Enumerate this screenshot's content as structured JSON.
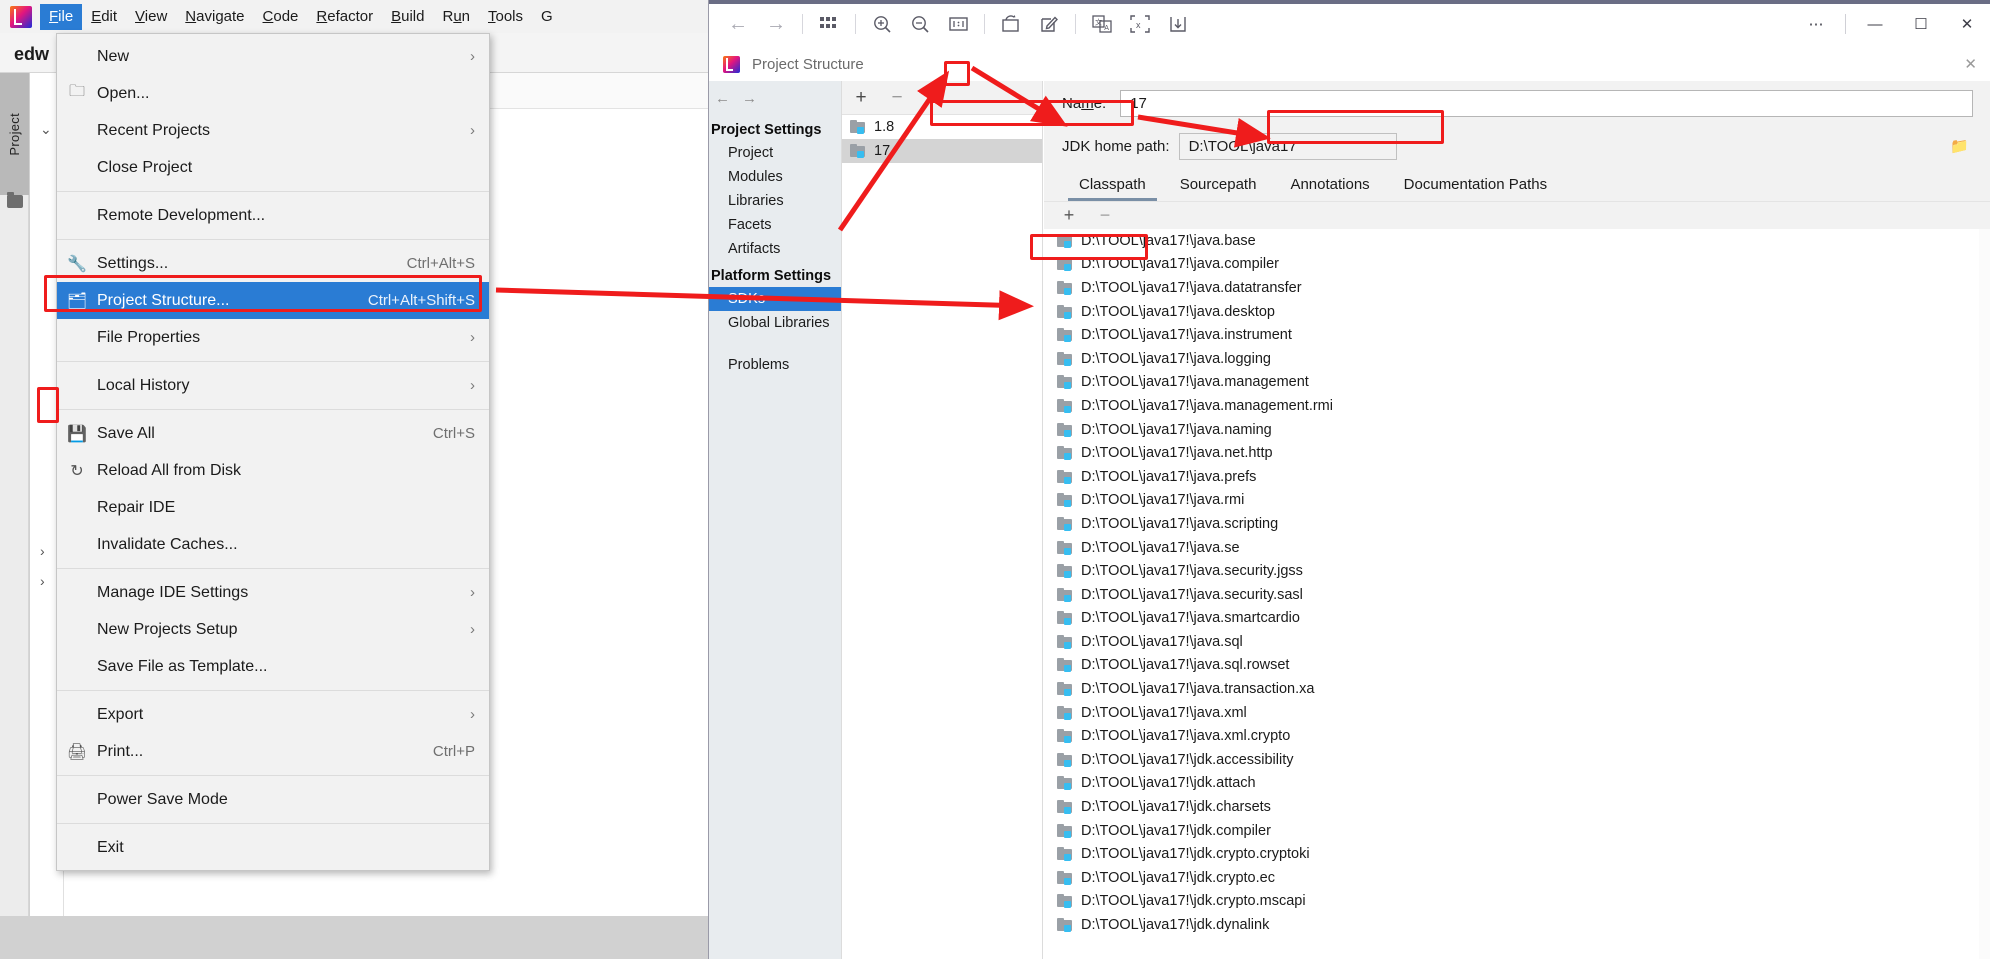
{
  "ide": {
    "logo_icon": "intellij-logo-icon",
    "tab_name": "edw",
    "stripe_label": "Project",
    "menubar": [
      {
        "label": "File",
        "mnemonic": "F",
        "active": true
      },
      {
        "label": "Edit",
        "mnemonic": "E",
        "active": false
      },
      {
        "label": "View",
        "mnemonic": "V",
        "active": false
      },
      {
        "label": "Navigate",
        "mnemonic": "N",
        "active": false
      },
      {
        "label": "Code",
        "mnemonic": "C",
        "active": false
      },
      {
        "label": "Refactor",
        "mnemonic": "R",
        "active": false
      },
      {
        "label": "Build",
        "mnemonic": "B",
        "active": false
      },
      {
        "label": "Run",
        "mnemonic": "u",
        "active": false
      },
      {
        "label": "Tools",
        "mnemonic": "T",
        "active": false
      },
      {
        "label": "G",
        "mnemonic": "",
        "active": false
      }
    ]
  },
  "file_menu": {
    "items": [
      {
        "label": "New",
        "mnemonic": "N",
        "accel": "",
        "arrow": true,
        "icon": "",
        "selected": false,
        "sep_after": false
      },
      {
        "label": "Open...",
        "mnemonic": "O",
        "accel": "",
        "arrow": false,
        "icon": "folder-icon",
        "selected": false,
        "sep_after": false
      },
      {
        "label": "Recent Projects",
        "mnemonic": "",
        "accel": "",
        "arrow": true,
        "icon": "",
        "selected": false,
        "sep_after": false
      },
      {
        "label": "Close Project",
        "mnemonic": "",
        "accel": "",
        "arrow": false,
        "icon": "",
        "selected": false,
        "sep_after": true
      },
      {
        "label": "Remote Development...",
        "mnemonic": "",
        "accel": "",
        "arrow": false,
        "icon": "",
        "selected": false,
        "sep_after": true
      },
      {
        "label": "Settings...",
        "mnemonic": "t",
        "accel": "Ctrl+Alt+S",
        "arrow": false,
        "icon": "wrench-icon",
        "selected": false,
        "sep_after": false
      },
      {
        "label": "Project Structure...",
        "mnemonic": "",
        "accel": "Ctrl+Alt+Shift+S",
        "arrow": false,
        "icon": "project-structure-icon",
        "selected": true,
        "sep_after": false
      },
      {
        "label": "File Properties",
        "mnemonic": "",
        "accel": "",
        "arrow": true,
        "icon": "",
        "selected": false,
        "sep_after": true
      },
      {
        "label": "Local History",
        "mnemonic": "H",
        "accel": "",
        "arrow": true,
        "icon": "",
        "selected": false,
        "sep_after": true
      },
      {
        "label": "Save All",
        "mnemonic": "S",
        "accel": "Ctrl+S",
        "arrow": false,
        "icon": "save-icon",
        "selected": false,
        "sep_after": false
      },
      {
        "label": "Reload All from Disk",
        "mnemonic": "",
        "accel": "",
        "arrow": false,
        "icon": "reload-icon",
        "selected": false,
        "sep_after": false
      },
      {
        "label": "Repair IDE",
        "mnemonic": "",
        "accel": "",
        "arrow": false,
        "icon": "",
        "selected": false,
        "sep_after": false
      },
      {
        "label": "Invalidate Caches...",
        "mnemonic": "",
        "accel": "",
        "arrow": false,
        "icon": "",
        "selected": false,
        "sep_after": true
      },
      {
        "label": "Manage IDE Settings",
        "mnemonic": "",
        "accel": "",
        "arrow": true,
        "icon": "",
        "selected": false,
        "sep_after": false
      },
      {
        "label": "New Projects Setup",
        "mnemonic": "",
        "accel": "",
        "arrow": true,
        "icon": "",
        "selected": false,
        "sep_after": false
      },
      {
        "label": "Save File as Template...",
        "mnemonic": "l",
        "accel": "",
        "arrow": false,
        "icon": "",
        "selected": false,
        "sep_after": true
      },
      {
        "label": "Export",
        "mnemonic": "",
        "accel": "",
        "arrow": true,
        "icon": "",
        "selected": false,
        "sep_after": false
      },
      {
        "label": "Print...",
        "mnemonic": "P",
        "accel": "Ctrl+P",
        "arrow": false,
        "icon": "printer-icon",
        "selected": false,
        "sep_after": true
      },
      {
        "label": "Power Save Mode",
        "mnemonic": "",
        "accel": "",
        "arrow": false,
        "icon": "",
        "selected": false,
        "sep_after": true
      },
      {
        "label": "Exit",
        "mnemonic": "x",
        "accel": "",
        "arrow": false,
        "icon": "",
        "selected": false,
        "sep_after": false
      }
    ]
  },
  "viewer_toolbar": {
    "icons": [
      "back-arrow-icon",
      "forward-arrow-icon",
      "sep",
      "thumbnails-grid-icon",
      "sep",
      "zoom-in-icon",
      "zoom-out-icon",
      "actual-size-icon",
      "sep",
      "rotate-icon",
      "edit-icon",
      "sep",
      "translate-icon",
      "extract-text-icon",
      "save-download-icon"
    ],
    "window_controls": [
      "more-options-icon",
      "minimize-icon",
      "maximize-icon",
      "close-icon"
    ]
  },
  "dialog": {
    "title": "Project Structure",
    "title_icon": "intellij-logo-icon",
    "close_icon": "close-icon",
    "nav": {
      "back_icon": "back-arrow-icon",
      "forward_icon": "forward-arrow-icon",
      "groups": [
        {
          "group": "Project Settings",
          "items": [
            "Project",
            "Modules",
            "Libraries",
            "Facets",
            "Artifacts"
          ]
        },
        {
          "group": "Platform Settings",
          "items": [
            "SDKs",
            "Global Libraries"
          ]
        }
      ],
      "selected_item": "SDKs",
      "problems_label": "Problems"
    },
    "sdk_list": {
      "add_label": "+",
      "remove_label": "−",
      "items": [
        {
          "label": "1.8",
          "selected": false
        },
        {
          "label": "17",
          "selected": true
        }
      ]
    },
    "detail": {
      "name_label": "Name:",
      "name_mnemonic": "m",
      "name_value": "17",
      "jdk_label": "JDK home path:",
      "jdk_value": "D:\\TOOL\\java17",
      "browse_icon": "folder-browse-icon",
      "tabs": [
        {
          "label": "Classpath",
          "selected": true
        },
        {
          "label": "Sourcepath",
          "selected": false
        },
        {
          "label": "Annotations",
          "selected": false
        },
        {
          "label": "Documentation Paths",
          "selected": false
        }
      ],
      "list_toolbar": {
        "add": "+",
        "remove": "−"
      },
      "classpath_entries": [
        "D:\\TOOL\\java17!\\java.base",
        "D:\\TOOL\\java17!\\java.compiler",
        "D:\\TOOL\\java17!\\java.datatransfer",
        "D:\\TOOL\\java17!\\java.desktop",
        "D:\\TOOL\\java17!\\java.instrument",
        "D:\\TOOL\\java17!\\java.logging",
        "D:\\TOOL\\java17!\\java.management",
        "D:\\TOOL\\java17!\\java.management.rmi",
        "D:\\TOOL\\java17!\\java.naming",
        "D:\\TOOL\\java17!\\java.net.http",
        "D:\\TOOL\\java17!\\java.prefs",
        "D:\\TOOL\\java17!\\java.rmi",
        "D:\\TOOL\\java17!\\java.scripting",
        "D:\\TOOL\\java17!\\java.se",
        "D:\\TOOL\\java17!\\java.security.jgss",
        "D:\\TOOL\\java17!\\java.security.sasl",
        "D:\\TOOL\\java17!\\java.smartcardio",
        "D:\\TOOL\\java17!\\java.sql",
        "D:\\TOOL\\java17!\\java.sql.rowset",
        "D:\\TOOL\\java17!\\java.transaction.xa",
        "D:\\TOOL\\java17!\\java.xml",
        "D:\\TOOL\\java17!\\java.xml.crypto",
        "D:\\TOOL\\java17!\\jdk.accessibility",
        "D:\\TOOL\\java17!\\jdk.attach",
        "D:\\TOOL\\java17!\\jdk.charsets",
        "D:\\TOOL\\java17!\\jdk.compiler",
        "D:\\TOOL\\java17!\\jdk.crypto.cryptoki",
        "D:\\TOOL\\java17!\\jdk.crypto.ec",
        "D:\\TOOL\\java17!\\jdk.crypto.mscapi",
        "D:\\TOOL\\java17!\\jdk.dynalink"
      ]
    }
  },
  "annotations": {
    "color": "#ef1c1c",
    "highlight_boxes": [
      "project-structure-menu-item",
      "sdks-nav-item",
      "sdk-add-button",
      "sdk-item-17",
      "jdk-home-path-field",
      "project-panel-selection"
    ],
    "arrows": [
      "menu-item-to-sdks-arrow",
      "add-button-to-sdk-17-arrow",
      "sdk-17-to-jdk-path-arrow",
      "modules-to-add-button-arrow"
    ]
  }
}
